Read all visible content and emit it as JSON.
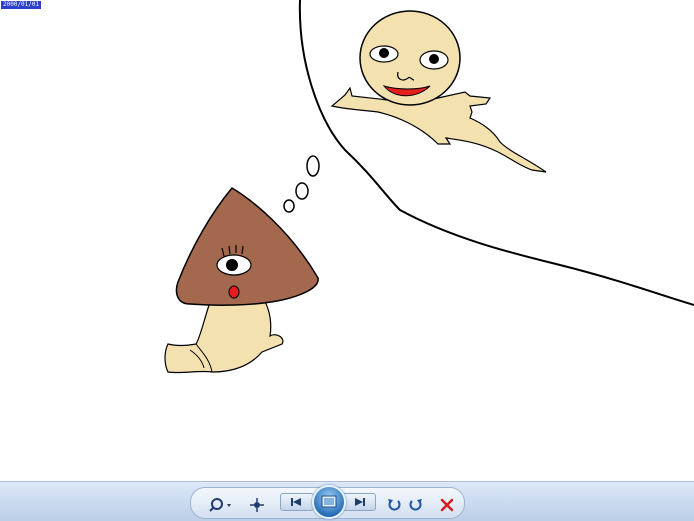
{
  "viewer": {
    "image_tag": "2000/01/01"
  },
  "toolbar": {
    "buttons": [
      {
        "name": "zoom-button",
        "icon": "magnifier-icon"
      },
      {
        "name": "actual-size-button",
        "icon": "fit-icon"
      },
      {
        "name": "previous-button",
        "icon": "previous-icon"
      },
      {
        "name": "slideshow-button",
        "icon": "slideshow-icon"
      },
      {
        "name": "next-button",
        "icon": "next-icon"
      },
      {
        "name": "rotate-counterclockwise-button",
        "icon": "rotate-ccw-icon"
      },
      {
        "name": "rotate-clockwise-button",
        "icon": "rotate-cw-icon"
      },
      {
        "name": "delete-button",
        "icon": "delete-icon"
      }
    ]
  },
  "colors": {
    "skin": "#f3e1b0",
    "hat": "#a4684e",
    "mouth": "#e41e1e",
    "toolbar": "#c9daf0",
    "delete": "#d22020"
  }
}
